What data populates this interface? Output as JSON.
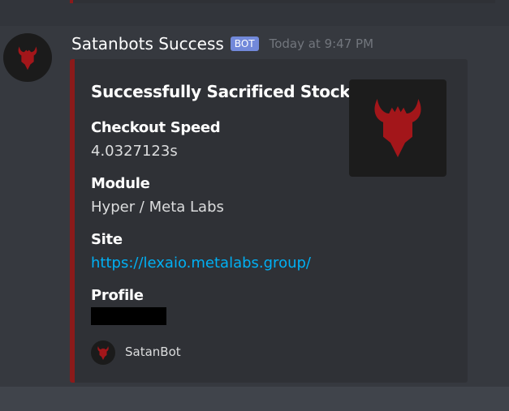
{
  "message": {
    "username": "Satanbots Success",
    "bot_tag": "BOT",
    "timestamp": "Today at 9:47 PM"
  },
  "embed": {
    "title": "Successfully Sacrificed Stock",
    "accent_color": "#8b1a1a",
    "fields": [
      {
        "name": "Checkout Speed",
        "value": "4.0327123s"
      },
      {
        "name": "Module",
        "value": "Hyper / Meta Labs"
      },
      {
        "name": "Site",
        "value": "https://lexaio.metalabs.group/"
      },
      {
        "name": "Profile",
        "value": ""
      }
    ],
    "footer": {
      "text": "SatanBot"
    }
  },
  "icons": {
    "avatar": "devil-head-icon",
    "thumbnail": "devil-head-icon",
    "footer": "devil-head-icon"
  }
}
